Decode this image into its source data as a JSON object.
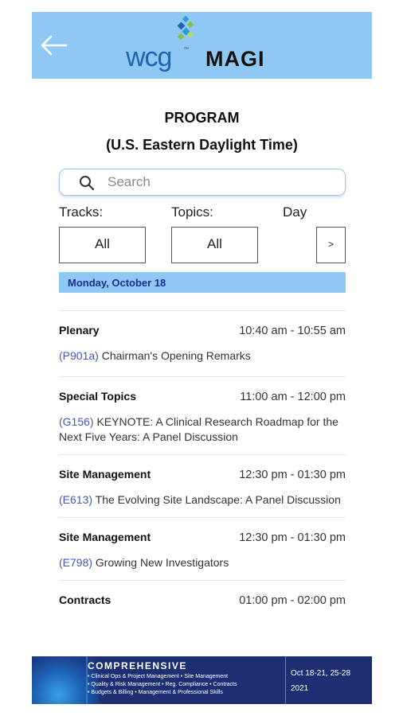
{
  "header": {
    "logo_brand": "wcg",
    "logo_product": "MAGI",
    "colors": {
      "header_bg": "#90c8f4",
      "brand_blue": "#1f64b0"
    }
  },
  "page": {
    "title": "PROGRAM",
    "subtitle": "(U.S. Eastern Daylight Time)"
  },
  "search": {
    "placeholder": "Search"
  },
  "filters": {
    "tracks_label": "Tracks:",
    "tracks_value": "All",
    "topics_label": "Topics:",
    "topics_value": "All",
    "day_label": "Day",
    "day_next": ">"
  },
  "day_header": "Monday, October 18",
  "sessions": [
    {
      "track": "Plenary",
      "time": "10:40 am - 10:55 am",
      "code": "(P901a)",
      "title": "Chairman's Opening Remarks"
    },
    {
      "track": "Special Topics",
      "time": "11:00 am - 12:00 pm",
      "code": "(G156)",
      "title": "KEYNOTE: A Clinical Research Roadmap for the Next Five Years: A Panel Discussion"
    },
    {
      "track": "Site Management",
      "time": "12:30 pm - 01:30 pm",
      "code": "(E613)",
      "title": "The Evolving Site Landscape: A Panel Discussion"
    },
    {
      "track": "Site Management",
      "time": "12:30 pm - 01:30 pm",
      "code": "(E798)",
      "title": "Growing New Investigators"
    },
    {
      "track": "Contracts",
      "time": "01:00 pm - 02:00 pm",
      "code": "",
      "title": ""
    }
  ],
  "banner": {
    "heading": "COMPREHENSIVE",
    "line1": "• Clinical Ops & Project Management  • Site Management",
    "line2": "• Quality & Risk Management  • Reg. Compliance  • Contracts",
    "line3": "• Budgets & Billing  • Management & Professional Skills",
    "dates_line1": "Oct 18-21, 25-28",
    "dates_line2": "2021"
  }
}
